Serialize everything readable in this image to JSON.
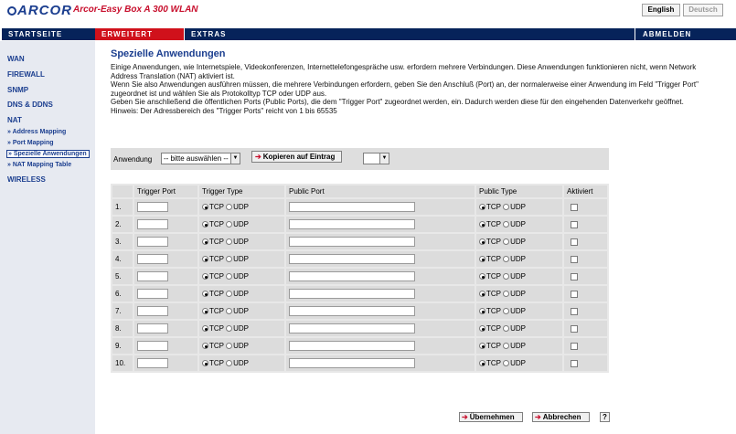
{
  "header": {
    "logo_text": "ARCOR",
    "model": "Arcor-Easy Box A 300 WLAN",
    "lang_en": "English",
    "lang_de": "Deutsch"
  },
  "nav": {
    "start": "STARTSEITE",
    "erweitert": "ERWEITERT",
    "extras": "EXTRAS",
    "abmelden": "ABMELDEN"
  },
  "sidebar": {
    "wan": "WAN",
    "firewall": "FIREWALL",
    "snmp": "SNMP",
    "dns": "DNS & DDNS",
    "nat": "NAT",
    "sub": [
      "» Address Mapping",
      "» Port Mapping",
      "» Spezielle Anwendungen",
      "» NAT Mapping Table"
    ],
    "wireless": "WIRELESS"
  },
  "main": {
    "title": "Spezielle Anwendungen",
    "intro": [
      "Einige Anwendungen, wie Internetspiele, Videokonferenzen, Internettelefongespräche usw. erfordern mehrere Verbindungen. Diese Anwendungen funktionieren nicht, wenn Network Address Translation (NAT) aktiviert ist.",
      "Wenn Sie also Anwendungen ausführen müssen, die mehrere Verbindungen erfordern, geben Sie den Anschluß (Port) an, der normalerweise einer Anwendung im Feld \"Trigger Port\" zugeordnet ist und wählen Sie als Protokolltyp TCP oder UDP aus.",
      "Geben Sie anschließend die öffentlichen Ports (Public Ports), die dem \"Trigger Port\" zugeordnet werden, ein. Dadurch werden diese für den eingehenden Datenverkehr geöffnet.",
      "Hinweis: Der Adressbereich des \"Trigger Ports\" reicht von 1 bis 65535"
    ],
    "app_label": "Anwendung",
    "app_select": "-- bitte auswählen --",
    "copy_button": "Kopieren auf Eintrag",
    "copy_arrow": "➔",
    "entry_select": ""
  },
  "table": {
    "headers": [
      "",
      "Trigger Port",
      "Trigger Type",
      "Public Port",
      "Public Type",
      "Aktiviert"
    ],
    "tcp": "TCP",
    "udp": "UDP",
    "rows": [
      {
        "num": "1."
      },
      {
        "num": "2."
      },
      {
        "num": "3."
      },
      {
        "num": "4."
      },
      {
        "num": "5."
      },
      {
        "num": "6."
      },
      {
        "num": "7."
      },
      {
        "num": "8."
      },
      {
        "num": "9."
      },
      {
        "num": "10."
      }
    ]
  },
  "footer": {
    "apply": "Übernehmen",
    "cancel": "Abbrechen",
    "help": "?",
    "arrow": "➔"
  },
  "colors": {
    "brand_blue": "#06235a",
    "accent_red": "#d0111b",
    "link_blue": "#1b3e8f"
  }
}
